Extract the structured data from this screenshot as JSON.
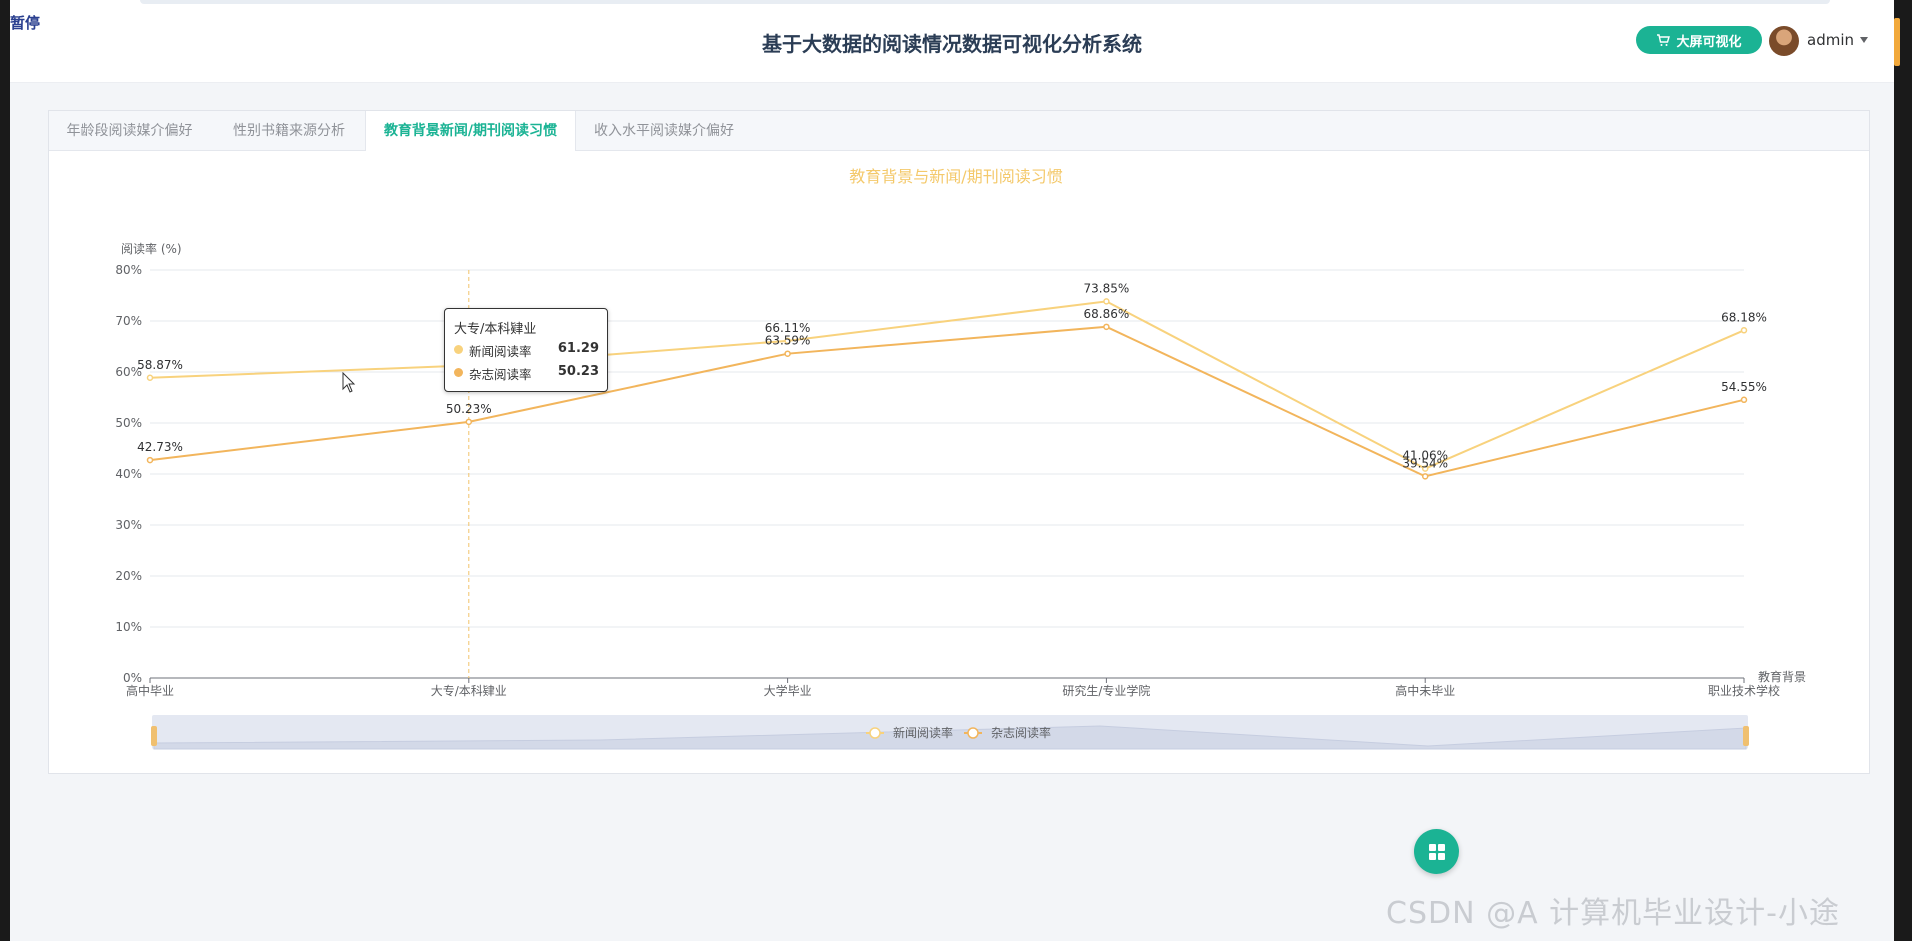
{
  "overlay": {
    "pause_label": "暂停"
  },
  "header": {
    "title": "基于大数据的阅读情况数据可视化分析系统",
    "bigscreen_button": "大屏可视化",
    "user": "admin"
  },
  "tabs": [
    {
      "label": "年龄段阅读媒介偏好",
      "active": false
    },
    {
      "label": "性别书籍来源分析",
      "active": false
    },
    {
      "label": "教育背景新闻/期刊阅读习惯",
      "active": true
    },
    {
      "label": "收入水平阅读媒介偏好",
      "active": false
    }
  ],
  "chart_data": {
    "type": "line",
    "title": "教育背景与新闻/期刊阅读习惯",
    "ylabel": "阅读率 (%)",
    "xlabel": "教育背景",
    "ylim": [
      0,
      80
    ],
    "y_ticks": [
      "0%",
      "10%",
      "20%",
      "30%",
      "40%",
      "50%",
      "60%",
      "70%",
      "80%"
    ],
    "categories": [
      "高中毕业",
      "大专/本科肄业",
      "大学毕业",
      "研究生/专业学院",
      "高中未毕业",
      "职业技术学校"
    ],
    "series": [
      {
        "name": "新闻阅读率",
        "color": "#f8d27d",
        "values": [
          58.87,
          61.29,
          66.11,
          73.85,
          41.06,
          68.18
        ],
        "labels": [
          "58.87%",
          "",
          "66.11%",
          "73.85%",
          "41.06%",
          "68.18%"
        ]
      },
      {
        "name": "杂志阅读率",
        "color": "#f2b55c",
        "values": [
          42.73,
          50.23,
          63.59,
          68.86,
          39.54,
          54.55
        ],
        "labels": [
          "42.73%",
          "50.23%",
          "63.59%",
          "68.86%",
          "39.54%",
          "54.55%"
        ]
      }
    ],
    "grid": true,
    "legend_position": "bottom",
    "tooltip": {
      "category": "大专/本科肄业",
      "rows": [
        {
          "name": "新闻阅读率",
          "value": "61.29",
          "color": "#f8d27d"
        },
        {
          "name": "杂志阅读率",
          "value": "50.23",
          "color": "#f2b55c"
        }
      ]
    },
    "hover_category_index": 1
  },
  "fab": {
    "icon": "grid-icon"
  },
  "watermark": "CSDN @A 计算机毕业设计-小途"
}
